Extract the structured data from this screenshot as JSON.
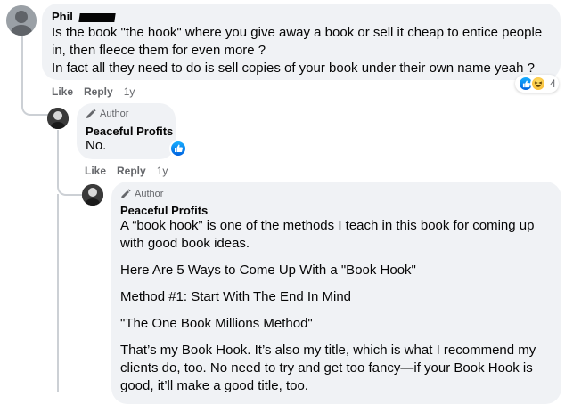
{
  "comment1": {
    "author": "Phil",
    "text_lines": [
      "Is the book \"the hook\" where you give away a book or sell it cheap to entice people",
      "in, then fleece them for even more ?",
      "In fact all they need to do is sell copies of your book under their own name yeah ?"
    ],
    "reaction_count": "4",
    "like_label": "Like",
    "reply_label": "Reply",
    "time": "1y"
  },
  "reply1": {
    "badge": "Author",
    "author": "Peaceful Profits",
    "text": "No.",
    "like_label": "Like",
    "reply_label": "Reply",
    "time": "1y"
  },
  "reply2": {
    "badge": "Author",
    "author": "Peaceful Profits",
    "paragraphs": [
      "A “book hook” is one of the methods I teach in this book for coming up with good book ideas.",
      "Here Are 5 Ways to Come Up With a \"Book Hook\"",
      "Method #1: Start With The End In Mind",
      "\"The One Book Millions Method\"",
      "That’s my Book Hook. It’s also my title, which is what I recommend my clients do, too. No need to try and get too fancy—if your Book Hook is good, it’ll make a good title, too."
    ]
  },
  "icons": {
    "like": "like-icon",
    "haha": "haha-icon",
    "pencil": "pencil-icon"
  },
  "colors": {
    "bubble": "#f0f2f5",
    "like_blue": "#1877f2",
    "meta_gray": "#65676b"
  }
}
